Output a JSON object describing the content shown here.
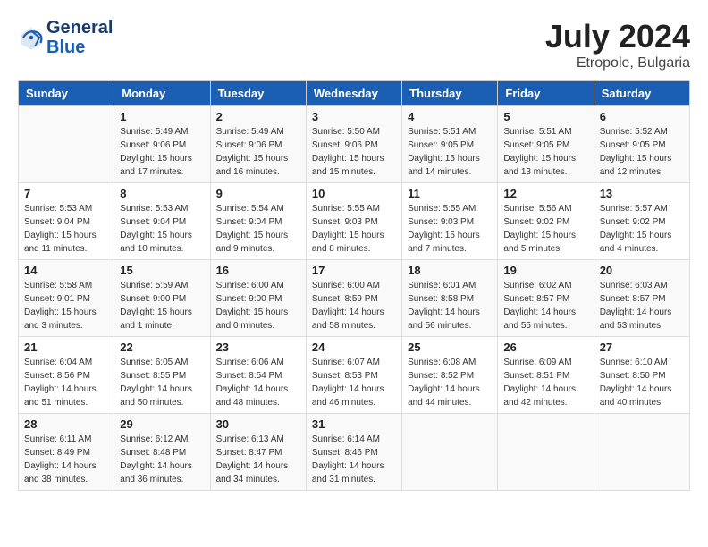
{
  "header": {
    "logo_line1": "General",
    "logo_line2": "Blue",
    "month_year": "July 2024",
    "location": "Etropole, Bulgaria"
  },
  "weekdays": [
    "Sunday",
    "Monday",
    "Tuesday",
    "Wednesday",
    "Thursday",
    "Friday",
    "Saturday"
  ],
  "weeks": [
    [
      {
        "day": "",
        "sunrise": "",
        "sunset": "",
        "daylight": ""
      },
      {
        "day": "1",
        "sunrise": "Sunrise: 5:49 AM",
        "sunset": "Sunset: 9:06 PM",
        "daylight": "Daylight: 15 hours and 17 minutes."
      },
      {
        "day": "2",
        "sunrise": "Sunrise: 5:49 AM",
        "sunset": "Sunset: 9:06 PM",
        "daylight": "Daylight: 15 hours and 16 minutes."
      },
      {
        "day": "3",
        "sunrise": "Sunrise: 5:50 AM",
        "sunset": "Sunset: 9:06 PM",
        "daylight": "Daylight: 15 hours and 15 minutes."
      },
      {
        "day": "4",
        "sunrise": "Sunrise: 5:51 AM",
        "sunset": "Sunset: 9:05 PM",
        "daylight": "Daylight: 15 hours and 14 minutes."
      },
      {
        "day": "5",
        "sunrise": "Sunrise: 5:51 AM",
        "sunset": "Sunset: 9:05 PM",
        "daylight": "Daylight: 15 hours and 13 minutes."
      },
      {
        "day": "6",
        "sunrise": "Sunrise: 5:52 AM",
        "sunset": "Sunset: 9:05 PM",
        "daylight": "Daylight: 15 hours and 12 minutes."
      }
    ],
    [
      {
        "day": "7",
        "sunrise": "Sunrise: 5:53 AM",
        "sunset": "Sunset: 9:04 PM",
        "daylight": "Daylight: 15 hours and 11 minutes."
      },
      {
        "day": "8",
        "sunrise": "Sunrise: 5:53 AM",
        "sunset": "Sunset: 9:04 PM",
        "daylight": "Daylight: 15 hours and 10 minutes."
      },
      {
        "day": "9",
        "sunrise": "Sunrise: 5:54 AM",
        "sunset": "Sunset: 9:04 PM",
        "daylight": "Daylight: 15 hours and 9 minutes."
      },
      {
        "day": "10",
        "sunrise": "Sunrise: 5:55 AM",
        "sunset": "Sunset: 9:03 PM",
        "daylight": "Daylight: 15 hours and 8 minutes."
      },
      {
        "day": "11",
        "sunrise": "Sunrise: 5:55 AM",
        "sunset": "Sunset: 9:03 PM",
        "daylight": "Daylight: 15 hours and 7 minutes."
      },
      {
        "day": "12",
        "sunrise": "Sunrise: 5:56 AM",
        "sunset": "Sunset: 9:02 PM",
        "daylight": "Daylight: 15 hours and 5 minutes."
      },
      {
        "day": "13",
        "sunrise": "Sunrise: 5:57 AM",
        "sunset": "Sunset: 9:02 PM",
        "daylight": "Daylight: 15 hours and 4 minutes."
      }
    ],
    [
      {
        "day": "14",
        "sunrise": "Sunrise: 5:58 AM",
        "sunset": "Sunset: 9:01 PM",
        "daylight": "Daylight: 15 hours and 3 minutes."
      },
      {
        "day": "15",
        "sunrise": "Sunrise: 5:59 AM",
        "sunset": "Sunset: 9:00 PM",
        "daylight": "Daylight: 15 hours and 1 minute."
      },
      {
        "day": "16",
        "sunrise": "Sunrise: 6:00 AM",
        "sunset": "Sunset: 9:00 PM",
        "daylight": "Daylight: 15 hours and 0 minutes."
      },
      {
        "day": "17",
        "sunrise": "Sunrise: 6:00 AM",
        "sunset": "Sunset: 8:59 PM",
        "daylight": "Daylight: 14 hours and 58 minutes."
      },
      {
        "day": "18",
        "sunrise": "Sunrise: 6:01 AM",
        "sunset": "Sunset: 8:58 PM",
        "daylight": "Daylight: 14 hours and 56 minutes."
      },
      {
        "day": "19",
        "sunrise": "Sunrise: 6:02 AM",
        "sunset": "Sunset: 8:57 PM",
        "daylight": "Daylight: 14 hours and 55 minutes."
      },
      {
        "day": "20",
        "sunrise": "Sunrise: 6:03 AM",
        "sunset": "Sunset: 8:57 PM",
        "daylight": "Daylight: 14 hours and 53 minutes."
      }
    ],
    [
      {
        "day": "21",
        "sunrise": "Sunrise: 6:04 AM",
        "sunset": "Sunset: 8:56 PM",
        "daylight": "Daylight: 14 hours and 51 minutes."
      },
      {
        "day": "22",
        "sunrise": "Sunrise: 6:05 AM",
        "sunset": "Sunset: 8:55 PM",
        "daylight": "Daylight: 14 hours and 50 minutes."
      },
      {
        "day": "23",
        "sunrise": "Sunrise: 6:06 AM",
        "sunset": "Sunset: 8:54 PM",
        "daylight": "Daylight: 14 hours and 48 minutes."
      },
      {
        "day": "24",
        "sunrise": "Sunrise: 6:07 AM",
        "sunset": "Sunset: 8:53 PM",
        "daylight": "Daylight: 14 hours and 46 minutes."
      },
      {
        "day": "25",
        "sunrise": "Sunrise: 6:08 AM",
        "sunset": "Sunset: 8:52 PM",
        "daylight": "Daylight: 14 hours and 44 minutes."
      },
      {
        "day": "26",
        "sunrise": "Sunrise: 6:09 AM",
        "sunset": "Sunset: 8:51 PM",
        "daylight": "Daylight: 14 hours and 42 minutes."
      },
      {
        "day": "27",
        "sunrise": "Sunrise: 6:10 AM",
        "sunset": "Sunset: 8:50 PM",
        "daylight": "Daylight: 14 hours and 40 minutes."
      }
    ],
    [
      {
        "day": "28",
        "sunrise": "Sunrise: 6:11 AM",
        "sunset": "Sunset: 8:49 PM",
        "daylight": "Daylight: 14 hours and 38 minutes."
      },
      {
        "day": "29",
        "sunrise": "Sunrise: 6:12 AM",
        "sunset": "Sunset: 8:48 PM",
        "daylight": "Daylight: 14 hours and 36 minutes."
      },
      {
        "day": "30",
        "sunrise": "Sunrise: 6:13 AM",
        "sunset": "Sunset: 8:47 PM",
        "daylight": "Daylight: 14 hours and 34 minutes."
      },
      {
        "day": "31",
        "sunrise": "Sunrise: 6:14 AM",
        "sunset": "Sunset: 8:46 PM",
        "daylight": "Daylight: 14 hours and 31 minutes."
      },
      {
        "day": "",
        "sunrise": "",
        "sunset": "",
        "daylight": ""
      },
      {
        "day": "",
        "sunrise": "",
        "sunset": "",
        "daylight": ""
      },
      {
        "day": "",
        "sunrise": "",
        "sunset": "",
        "daylight": ""
      }
    ]
  ]
}
